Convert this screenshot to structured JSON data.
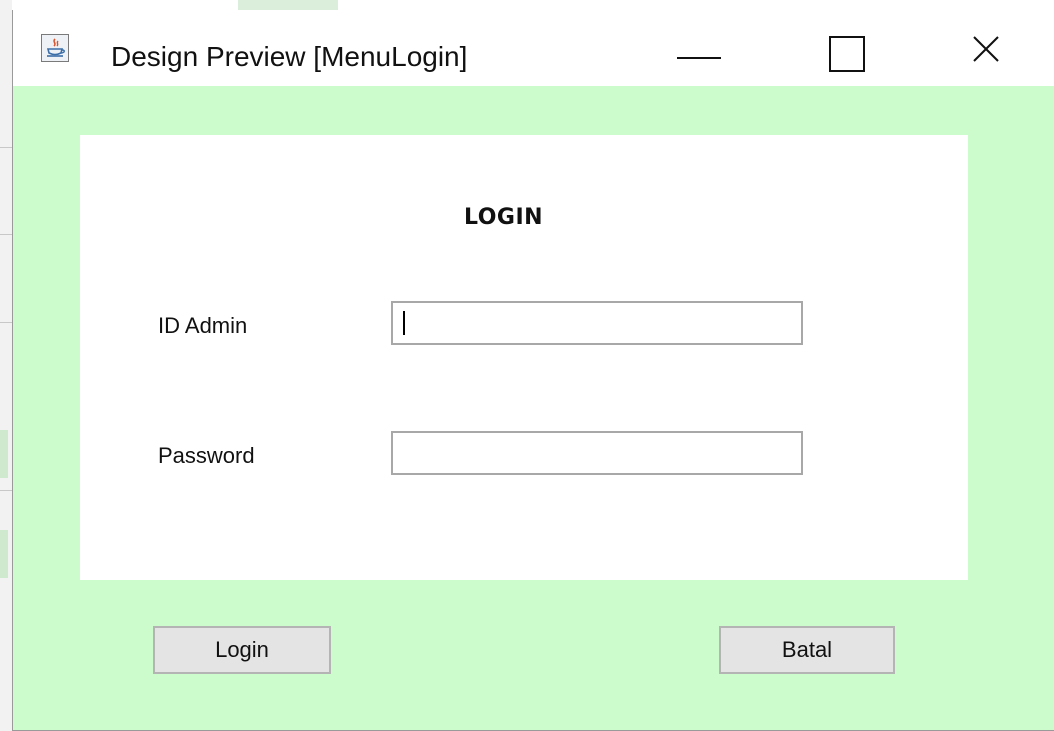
{
  "window": {
    "title": "Design Preview [MenuLogin]",
    "background_color": "#ccfccc"
  },
  "titlebar": {
    "app_icon": "java-icon",
    "controls": [
      "minimize-icon",
      "maximize-icon",
      "close-icon"
    ]
  },
  "form": {
    "heading": "LOGIN",
    "id_label": "ID Admin",
    "id_value": "",
    "password_label": "Password",
    "password_value": ""
  },
  "buttons": {
    "login_label": "Login",
    "cancel_label": "Batal"
  }
}
